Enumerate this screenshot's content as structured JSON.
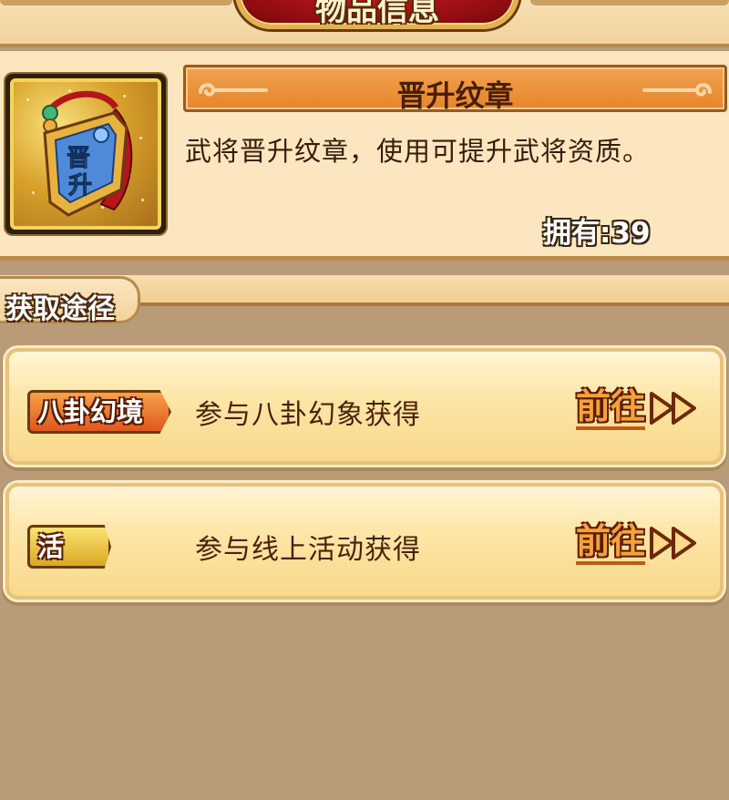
{
  "header": {
    "title": "物品信息"
  },
  "item": {
    "name": "晋升纹章",
    "icon": "promotion-badge-icon",
    "icon_text": "晋升",
    "description": "武将晋升纹章，使用可提升武将资质。",
    "owned_label": "拥有:",
    "owned_count": "39"
  },
  "sources": {
    "section_label": "获取途径",
    "rows": [
      {
        "tag": "八卦幻境",
        "description": "参与八卦幻象获得",
        "action": "前往"
      },
      {
        "tag": "活动",
        "description": "参与线上活动获得",
        "action": "前往"
      }
    ]
  },
  "colors": {
    "title_plaque": "#a31216",
    "name_banner": "#e98f36",
    "panel_bg": "#fbe6bf",
    "body_bg": "#b99c77",
    "goto_text": "#f6a13c"
  }
}
